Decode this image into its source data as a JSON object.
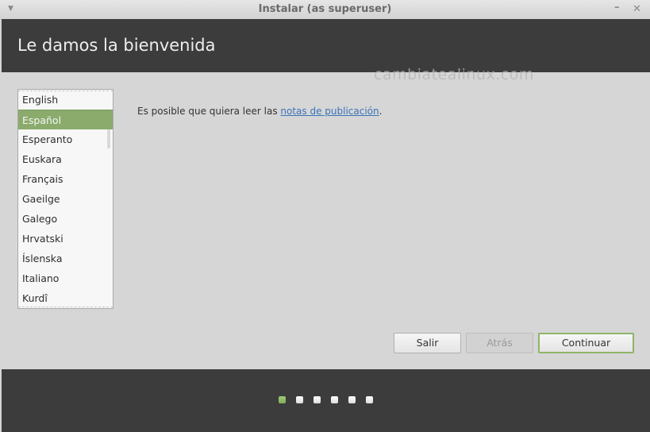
{
  "window": {
    "title": "Instalar (as superuser)",
    "menu_icon": "▼",
    "minimize_icon": "–",
    "close_icon": "✕"
  },
  "header": {
    "title": "Le damos la bienvenida"
  },
  "watermark": "cambiatealinux.com",
  "languages": {
    "items": [
      "English",
      "Español",
      "Esperanto",
      "Euskara",
      "Français",
      "Gaeilge",
      "Galego",
      "Hrvatski",
      "Íslenska",
      "Italiano",
      "Kurdî"
    ],
    "selected": "Español"
  },
  "notes": {
    "prefix": "Es posible que quiera leer las ",
    "link": "notas de publicación",
    "suffix": "."
  },
  "buttons": {
    "quit": "Salir",
    "back": "Atrás",
    "continue": "Continuar"
  },
  "progress": {
    "total_steps": 6,
    "current_step": 1,
    "active_color": "#8bbd63"
  }
}
